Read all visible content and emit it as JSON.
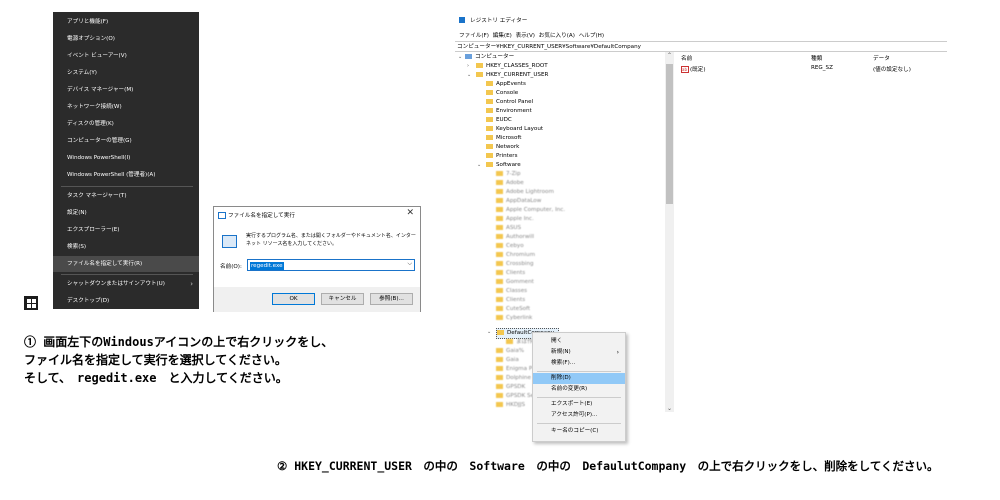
{
  "winx_menu": {
    "items": [
      "アプリと機能(F)",
      "電源オプション(O)",
      "イベント ビューアー(V)",
      "システム(Y)",
      "デバイス マネージャー(M)",
      "ネットワーク接続(W)",
      "ディスクの管理(K)",
      "コンピューターの管理(G)",
      "Windows PowerShell(I)",
      "Windows PowerShell (管理者)(A)",
      "タスク マネージャー(T)",
      "設定(N)",
      "エクスプローラー(E)",
      "検索(S)",
      "ファイル名を指定して実行(R)",
      "シャットダウンまたはサインアウト(U)",
      "デスクトップ(D)"
    ],
    "selected": "ファイル名を指定して実行(R)"
  },
  "run_dialog": {
    "title": "ファイル名を指定して実行",
    "close": "✕",
    "description": "実行するプログラム名、または開くフォルダーやドキュメント名、インターネット リソース名を入力してください。",
    "name_label": "名前(O):",
    "name_value": "regedit.exe",
    "ok": "OK",
    "cancel": "キャンセル",
    "browse": "参照(B)..."
  },
  "caption1": {
    "line1": "① 画面左下のWindousアイコンの上で右クリックをし、",
    "line2": "ファイル名を指定して実行を選択してください。",
    "line3": "そして、　regedit.exe　と入力してください。"
  },
  "regedit": {
    "title": "レジストリ エディター",
    "menu": "ファイル(F)  編集(E)  表示(V)  お気に入り(A)  ヘルプ(H)",
    "address": "コンピューター¥HKEY_CURRENT_USER¥Software¥DefaultCompany",
    "tree": {
      "computer": "コンピューター",
      "hkcr": "HKEY_CLASSES_ROOT",
      "hkcu": "HKEY_CURRENT_USER",
      "hkcu_children": [
        "AppEvents",
        "Console",
        "Control Panel",
        "Environment",
        "EUDC",
        "Keyboard Layout",
        "Microsoft",
        "Network",
        "Printers"
      ],
      "software": "Software",
      "software_children_blurred": [
        "7-Zip",
        "Adobe",
        "Adobe Lightroom",
        "AppDataLow",
        "Apple Computer, Inc.",
        "Apple Inc.",
        "ASUS",
        "Authorwill",
        "Cebyo",
        "Chromium",
        "Crossbing",
        "Clients",
        "Gomment",
        "Classes",
        "Clients",
        "CuteSoft",
        "Cyberlink"
      ],
      "default_company": "DefaultCompany",
      "dc_child_blurred": "まぼ作",
      "below_blurred": [
        "Gaia%",
        "Gaia",
        "Enigma P",
        "Dolphine",
        "GPSDK",
        "GPSDK Set",
        "HKDJJS"
      ]
    },
    "columns": {
      "name": "名前",
      "type": "種類",
      "data": "データ"
    },
    "row": {
      "icon": "ab",
      "name": "(既定)",
      "type": "REG_SZ",
      "data": "(値の設定なし)"
    }
  },
  "context_menu": {
    "items": [
      "開く",
      "新規(N)",
      "検索(F)...",
      "削除(D)",
      "名前の変更(R)",
      "エクスポート(E)",
      "アクセス許可(P)...",
      "キー名のコピー(C)"
    ],
    "selected": "削除(D)"
  },
  "caption2": "② HKEY_CURRENT_USER　の中の　Software　の中の　DefaulutCompany　の上で右クリックをし、削除をしてください。"
}
